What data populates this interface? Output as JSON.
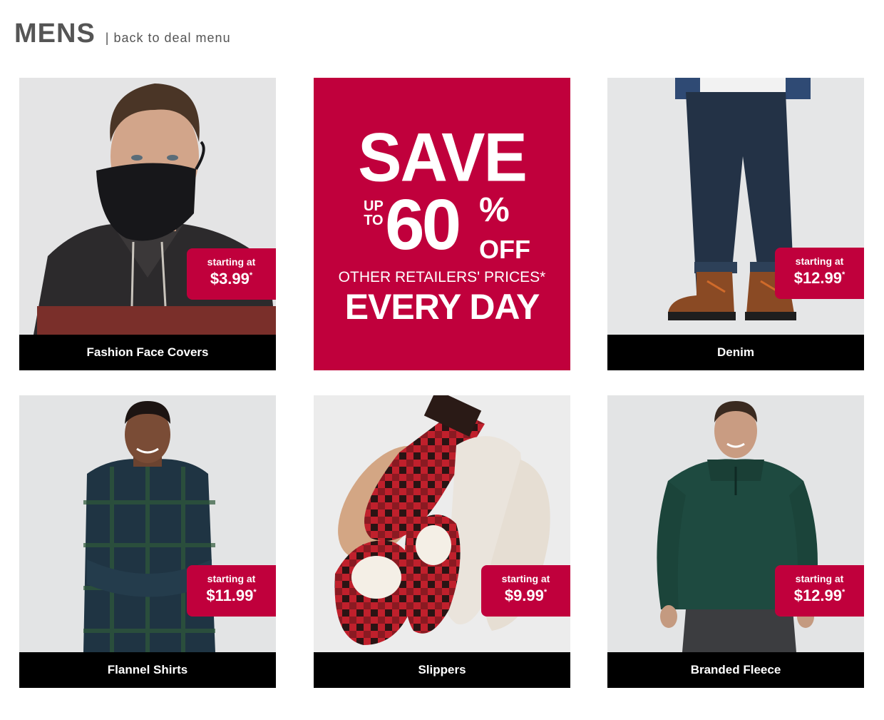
{
  "header": {
    "title": "MENS",
    "separator": "|",
    "back_link": "back to deal menu"
  },
  "promo": {
    "save": "SAVE",
    "up": "UP",
    "to": "TO",
    "amount": "60",
    "percent": "%",
    "off": "OFF",
    "other_retailers": "OTHER RETAILERS' PRICES*",
    "every_day": "EVERY DAY"
  },
  "tiles": [
    {
      "label": "Fashion Face Covers",
      "starting": "starting at",
      "price": "$3.99",
      "asterisk": "*",
      "image": "man-wearing-face-mask"
    },
    {
      "label": "Denim",
      "starting": "starting at",
      "price": "$12.99",
      "asterisk": "*",
      "image": "jeans-and-boots"
    },
    {
      "label": "Flannel Shirts",
      "starting": "starting at",
      "price": "$11.99",
      "asterisk": "*",
      "image": "man-in-flannel-shirt"
    },
    {
      "label": "Slippers",
      "starting": "starting at",
      "price": "$9.99",
      "asterisk": "*",
      "image": "plaid-and-sherpa-slippers"
    },
    {
      "label": "Branded Fleece",
      "starting": "starting at",
      "price": "$12.99",
      "asterisk": "*",
      "image": "man-in-green-fleece"
    }
  ],
  "colors": {
    "accent": "#c0003c",
    "label_bar": "#000000",
    "title_text": "#555555"
  }
}
